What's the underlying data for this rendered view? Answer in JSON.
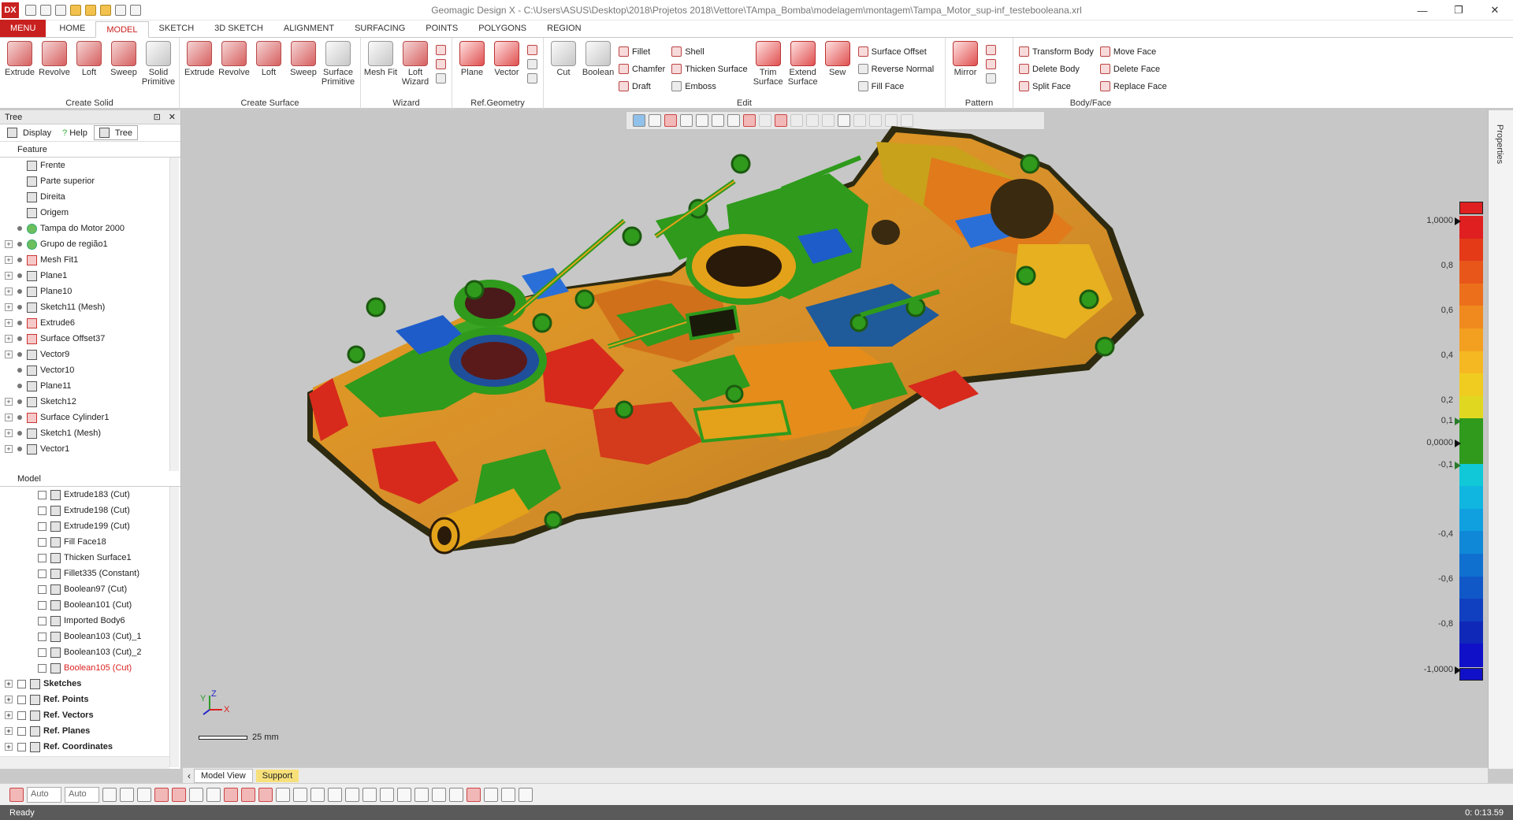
{
  "app": {
    "logo": "DX",
    "title": "Geomagic Design X - C:\\Users\\ASUS\\Desktop\\2018\\Projetos 2018\\Vettore\\TAmpa_Bomba\\modelagem\\montagem\\Tampa_Motor_sup-inf_testebooleana.xrl",
    "win_min": "—",
    "win_max": "❐",
    "win_close": "✕"
  },
  "tabs": [
    "MENU",
    "HOME",
    "MODEL",
    "SKETCH",
    "3D SKETCH",
    "ALIGNMENT",
    "SURFACING",
    "POINTS",
    "POLYGONS",
    "REGION"
  ],
  "ribbon": {
    "create_solid": {
      "label": "Create Solid",
      "items": [
        "Extrude",
        "Revolve",
        "Loft",
        "Sweep",
        "Solid Primitive"
      ]
    },
    "create_surface": {
      "label": "Create Surface",
      "items": [
        "Extrude",
        "Revolve",
        "Loft",
        "Sweep",
        "Surface Primitive"
      ]
    },
    "wizard": {
      "label": "Wizard",
      "items": [
        "Mesh Fit",
        "Loft Wizard"
      ]
    },
    "ref_geometry": {
      "label": "Ref.Geometry",
      "items": [
        "Plane",
        "Vector"
      ]
    },
    "edit": {
      "label": "Edit",
      "big": [
        "Cut",
        "Boolean"
      ],
      "col1": [
        "Fillet",
        "Chamfer",
        "Draft"
      ],
      "col2": [
        "Shell",
        "Thicken Surface",
        "Emboss"
      ],
      "big2": [
        "Trim Surface",
        "Extend Surface",
        "Sew"
      ],
      "col3": [
        "Surface Offset",
        "Reverse Normal",
        "Fill Face"
      ]
    },
    "pattern": {
      "label": "Pattern",
      "items": [
        "Mirror"
      ]
    },
    "body_face": {
      "label": "Body/Face",
      "col1": [
        "Transform Body",
        "Delete Body",
        "Split Face"
      ],
      "col2": [
        "Move Face",
        "Delete Face",
        "Replace Face"
      ]
    }
  },
  "tree_panel": {
    "title": "Tree",
    "pin": "⊡",
    "close": "✕",
    "tabs": [
      "Display",
      "Help",
      "Tree"
    ],
    "feature_header": "Feature",
    "features": [
      {
        "label": "Frente",
        "icon": "plane",
        "exp": false
      },
      {
        "label": "Parte superior",
        "icon": "plane",
        "exp": false
      },
      {
        "label": "Direita",
        "icon": "plane",
        "exp": false
      },
      {
        "label": "Origem",
        "icon": "coord",
        "exp": false
      },
      {
        "label": "Tampa do Motor 2000",
        "icon": "mesh",
        "exp": false,
        "dot": true
      },
      {
        "label": "Grupo de região1",
        "icon": "region",
        "exp": true,
        "dot": true
      },
      {
        "label": "Mesh Fit1",
        "icon": "meshfit",
        "exp": true,
        "dot": true
      },
      {
        "label": "Plane1",
        "icon": "plane",
        "exp": true,
        "dot": true
      },
      {
        "label": "Plane10",
        "icon": "plane",
        "exp": true,
        "dot": true
      },
      {
        "label": "Sketch11 (Mesh)",
        "icon": "sketch",
        "exp": true,
        "dot": true
      },
      {
        "label": "Extrude6",
        "icon": "extrude",
        "exp": true,
        "dot": true
      },
      {
        "label": "Surface Offset37",
        "icon": "offset",
        "exp": true,
        "dot": true
      },
      {
        "label": "Vector9",
        "icon": "vector",
        "exp": true,
        "dot": true
      },
      {
        "label": "Vector10",
        "icon": "vector",
        "exp": false,
        "dot": true
      },
      {
        "label": "Plane11",
        "icon": "plane",
        "exp": false,
        "dot": true
      },
      {
        "label": "Sketch12",
        "icon": "sketch",
        "exp": true,
        "dot": true
      },
      {
        "label": "Surface Cylinder1",
        "icon": "cyl",
        "exp": true,
        "dot": true
      },
      {
        "label": "Sketch1 (Mesh)",
        "icon": "sketch",
        "exp": true,
        "dot": true
      },
      {
        "label": "Vector1",
        "icon": "vector",
        "exp": true,
        "dot": true
      }
    ],
    "model_header": "Model",
    "model": [
      {
        "label": "Extrude183 (Cut)",
        "icon": "body",
        "exp": false,
        "indent": true
      },
      {
        "label": "Extrude198 (Cut)",
        "icon": "body",
        "exp": false,
        "indent": true
      },
      {
        "label": "Extrude199 (Cut)",
        "icon": "body",
        "exp": false,
        "indent": true
      },
      {
        "label": "Fill Face18",
        "icon": "body",
        "exp": false,
        "indent": true
      },
      {
        "label": "Thicken Surface1",
        "icon": "body",
        "exp": false,
        "indent": true
      },
      {
        "label": "Fillet335 (Constant)",
        "icon": "body",
        "exp": false,
        "indent": true
      },
      {
        "label": "Boolean97 (Cut)",
        "icon": "body",
        "exp": false,
        "indent": true
      },
      {
        "label": "Boolean101 (Cut)",
        "icon": "body",
        "exp": false,
        "indent": true
      },
      {
        "label": "Imported Body6",
        "icon": "body",
        "exp": false,
        "indent": true
      },
      {
        "label": "Boolean103 (Cut)_1",
        "icon": "body",
        "exp": false,
        "indent": true
      },
      {
        "label": "Boolean103 (Cut)_2",
        "icon": "body",
        "exp": false,
        "indent": true
      },
      {
        "label": "Boolean105 (Cut)",
        "icon": "body",
        "exp": false,
        "indent": true,
        "red": true
      },
      {
        "label": "Sketches",
        "icon": "folder",
        "exp": true,
        "bold": true
      },
      {
        "label": "Ref. Points",
        "icon": "folder",
        "exp": true,
        "bold": true
      },
      {
        "label": "Ref. Vectors",
        "icon": "folder",
        "exp": true,
        "bold": true
      },
      {
        "label": "Ref. Planes",
        "icon": "folder",
        "exp": true,
        "bold": true
      },
      {
        "label": "Ref. Coordinates",
        "icon": "folder",
        "exp": true,
        "bold": true
      }
    ]
  },
  "viewport": {
    "scale_label": "25 mm",
    "axis_y": "Y",
    "axis_z": "Z",
    "axis_x": "X",
    "colorbar": {
      "labels": [
        "1,0000",
        "0,8",
        "0,6",
        "0,4",
        "0,2",
        "0,1",
        "0,0000",
        "-0,1",
        "-0,4",
        "-0,6",
        "-0,8",
        "-1,0000"
      ],
      "top_color": "#e02020",
      "bottom_color": "#1010c8"
    }
  },
  "right_panel": {
    "label": "Properties"
  },
  "view_tabs": [
    "Model View",
    "Support"
  ],
  "bottom_toolbar": {
    "combo1": "Auto",
    "combo2": "Auto"
  },
  "status": {
    "left": "Ready",
    "right": "0: 0:13.59"
  }
}
